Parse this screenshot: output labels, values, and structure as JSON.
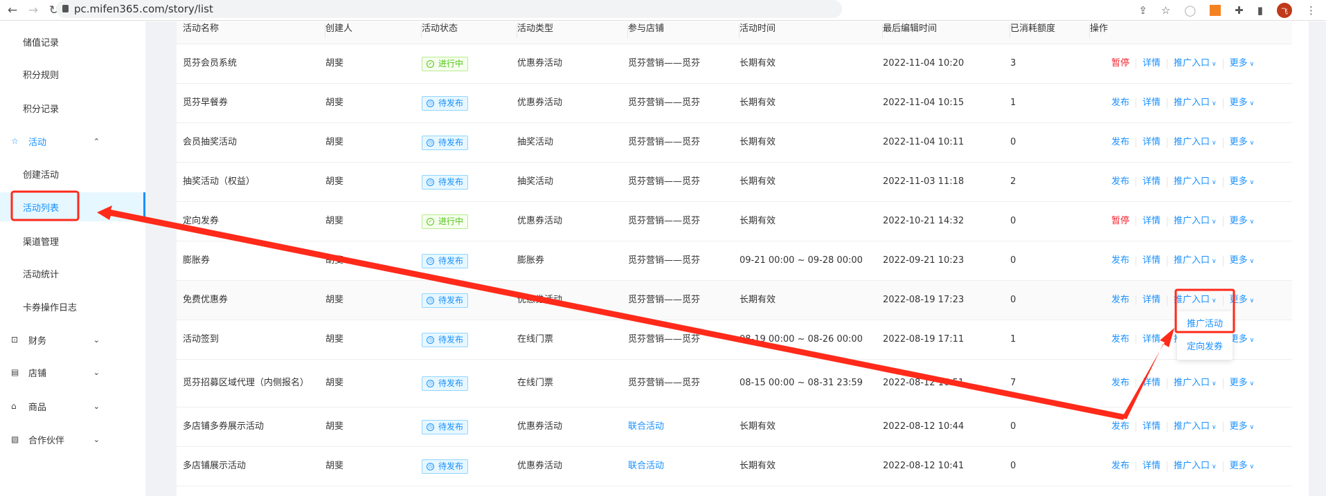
{
  "browser": {
    "url": "pc.mifen365.com/story/list",
    "avatar_letter": "飞"
  },
  "sidebar": {
    "items": [
      {
        "label": "储值记录",
        "type": "sub"
      },
      {
        "label": "积分规则",
        "type": "sub"
      },
      {
        "label": "积分记录",
        "type": "sub"
      },
      {
        "label": "活动",
        "type": "group",
        "icon": "star-icon",
        "open": true
      },
      {
        "label": "创建活动",
        "type": "sub"
      },
      {
        "label": "活动列表",
        "type": "sub",
        "active": true
      },
      {
        "label": "渠道管理",
        "type": "sub"
      },
      {
        "label": "活动统计",
        "type": "sub"
      },
      {
        "label": "卡券操作日志",
        "type": "sub"
      },
      {
        "label": "财务",
        "type": "group",
        "icon": "finance-icon"
      },
      {
        "label": "店铺",
        "type": "group",
        "icon": "store-icon"
      },
      {
        "label": "商品",
        "type": "group",
        "icon": "bag-icon"
      },
      {
        "label": "合作伙伴",
        "type": "group",
        "icon": "partner-icon"
      }
    ]
  },
  "table": {
    "columns": [
      "活动名称",
      "创建人",
      "活动状态",
      "活动类型",
      "参与店铺",
      "活动时间",
      "最后编辑时间",
      "已消耗额度",
      "操作"
    ],
    "rows": [
      {
        "name": "觅芬会员系统",
        "creator": "胡斐",
        "status": "进行中",
        "type": "优惠券活动",
        "store": "觅芬营销——觅芬",
        "time": "长期有效",
        "edited": "2022-11-04 10:20",
        "used": "3",
        "op1": "暂停"
      },
      {
        "name": "觅芬早餐券",
        "creator": "胡斐",
        "status": "待发布",
        "type": "优惠券活动",
        "store": "觅芬营销——觅芬",
        "time": "长期有效",
        "edited": "2022-11-04 10:15",
        "used": "1",
        "op1": "发布"
      },
      {
        "name": "会员抽奖活动",
        "creator": "胡斐",
        "status": "待发布",
        "type": "抽奖活动",
        "store": "觅芬营销——觅芬",
        "time": "长期有效",
        "edited": "2022-11-04 10:11",
        "used": "0",
        "op1": "发布"
      },
      {
        "name": "抽奖活动（权益）",
        "creator": "胡斐",
        "status": "待发布",
        "type": "抽奖活动",
        "store": "觅芬营销——觅芬",
        "time": "长期有效",
        "edited": "2022-11-03 11:18",
        "used": "2",
        "op1": "发布"
      },
      {
        "name": "定向发券",
        "creator": "胡斐",
        "status": "进行中",
        "type": "优惠券活动",
        "store": "觅芬营销——觅芬",
        "time": "长期有效",
        "edited": "2022-10-21 14:32",
        "used": "0",
        "op1": "暂停"
      },
      {
        "name": "膨胀券",
        "creator": "胡斐",
        "status": "待发布",
        "type": "膨胀券",
        "store": "觅芬营销——觅芬",
        "time": "09-21 00:00 ~ 09-28 00:00",
        "edited": "2022-09-21 10:23",
        "used": "0",
        "op1": "发布"
      },
      {
        "name": "免费优惠券",
        "creator": "胡斐",
        "status": "待发布",
        "type": "优惠券活动",
        "store": "觅芬营销——觅芬",
        "time": "长期有效",
        "edited": "2022-08-19 17:23",
        "used": "0",
        "op1": "发布"
      },
      {
        "name": "活动签到",
        "creator": "胡斐",
        "status": "待发布",
        "type": "在线门票",
        "store": "觅芬营销——觅芬",
        "time": "08-19 00:00 ~ 08-26 00:00",
        "edited": "2022-08-19 17:11",
        "used": "1",
        "op1": "发布"
      },
      {
        "name": "觅芬招募区域代理（内侧报名）",
        "creator": "胡斐",
        "status": "待发布",
        "type": "在线门票",
        "store": "觅芬营销——觅芬",
        "time": "08-15 00:00 ~ 08-31 23:59",
        "edited": "2022-08-12 16:51",
        "used": "7",
        "op1": "发布"
      },
      {
        "name": "多店铺多券展示活动",
        "creator": "胡斐",
        "status": "待发布",
        "type": "优惠券活动",
        "store": "联合活动",
        "store_link": true,
        "time": "长期有效",
        "edited": "2022-08-12 10:44",
        "used": "0",
        "op1": "发布"
      },
      {
        "name": "多店铺展示活动",
        "creator": "胡斐",
        "status": "待发布",
        "type": "优惠券活动",
        "store": "联合活动",
        "store_link": true,
        "time": "长期有效",
        "edited": "2022-08-12 10:41",
        "used": "0",
        "op1": "发布"
      }
    ],
    "op_detail": "详情",
    "op_promo": "推广入口",
    "op_more": "更多"
  },
  "dropdown": {
    "items": [
      "推广活动",
      "定向发券"
    ]
  },
  "colors": {
    "primary": "#1890ff",
    "danger": "#f5222d",
    "success": "#52c41a",
    "annotation": "#ff2a1a"
  }
}
